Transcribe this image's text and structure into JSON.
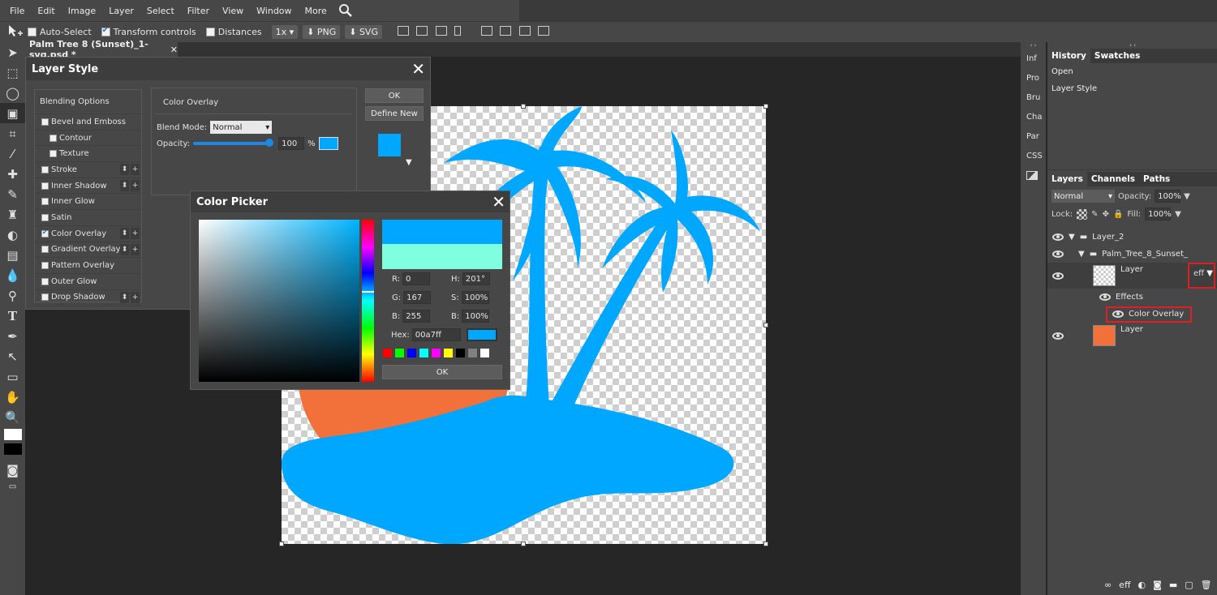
{
  "menu": [
    "File",
    "Edit",
    "Image",
    "Layer",
    "Select",
    "Filter",
    "View",
    "Window",
    "More"
  ],
  "options": {
    "auto_select": "Auto-Select",
    "transform_controls": "Transform controls",
    "distances": "Distances",
    "zoom": "1x",
    "png": "PNG",
    "svg": "SVG"
  },
  "doc_tab": {
    "title": "Palm Tree 8 (Sunset)_1-svg.psd *",
    "close": "✕"
  },
  "layer_style": {
    "title": "Layer Style",
    "close": "✕",
    "items": [
      {
        "label": "Blending Options",
        "check": false,
        "head": true
      },
      {
        "label": "Bevel and Emboss",
        "check": false
      },
      {
        "label": "Contour",
        "check": false,
        "sub": true
      },
      {
        "label": "Texture",
        "check": false,
        "sub": true
      },
      {
        "label": "Stroke",
        "check": false,
        "btns": true
      },
      {
        "label": "Inner Shadow",
        "check": false,
        "btns": true
      },
      {
        "label": "Inner Glow",
        "check": false
      },
      {
        "label": "Satin",
        "check": false
      },
      {
        "label": "Color Overlay",
        "check": true,
        "btns": true
      },
      {
        "label": "Gradient Overlay",
        "check": false,
        "btns": true
      },
      {
        "label": "Pattern Overlay",
        "check": false
      },
      {
        "label": "Outer Glow",
        "check": false
      },
      {
        "label": "Drop Shadow",
        "check": false,
        "btns": true
      }
    ],
    "section_title": "Color Overlay",
    "blend_mode_label": "Blend Mode:",
    "blend_mode_value": "Normal",
    "opacity_label": "Opacity:",
    "opacity_value": "100",
    "opacity_unit": "%",
    "ok": "OK",
    "define_new": "Define New",
    "overlay_color": "#00a7ff"
  },
  "color_picker": {
    "title": "Color Picker",
    "close": "✕",
    "r_label": "R:",
    "r": "0",
    "g_label": "G:",
    "g": "167",
    "b_label": "B:",
    "b": "255",
    "h_label": "H:",
    "h": "201°",
    "s_label": "S:",
    "s": "100%",
    "bv_label": "B:",
    "bv": "100%",
    "hex_label": "Hex:",
    "hex": "00a7ff",
    "new_color": "#00a7ff",
    "old_color": "#7fffe0",
    "palette": [
      "#ff0000",
      "#00ff00",
      "#0000ff",
      "#00ffff",
      "#ff00ff",
      "#ffff00",
      "#000000",
      "#808080",
      "#ffffff"
    ],
    "ok": "OK"
  },
  "right_tabs": [
    "Inf",
    "Pro",
    "Bru",
    "Cha",
    "Par",
    "CSS"
  ],
  "history": {
    "tabs": [
      "History",
      "Swatches"
    ],
    "items": [
      "Open",
      "Layer Style"
    ]
  },
  "layers": {
    "tabs": [
      "Layers",
      "Channels",
      "Paths"
    ],
    "blend": "Normal",
    "opacity_label": "Opacity:",
    "opacity": "100%",
    "lock_label": "Lock:",
    "fill_label": "Fill:",
    "fill": "100%",
    "rows": {
      "group1": "Layer_2",
      "group2": "Palm_Tree_8_Sunset_",
      "layer1": "Layer",
      "eff": "eff",
      "effects": "Effects",
      "color_overlay": "Color Overlay",
      "layer2": "Layer"
    },
    "footer_eff": "eff"
  }
}
